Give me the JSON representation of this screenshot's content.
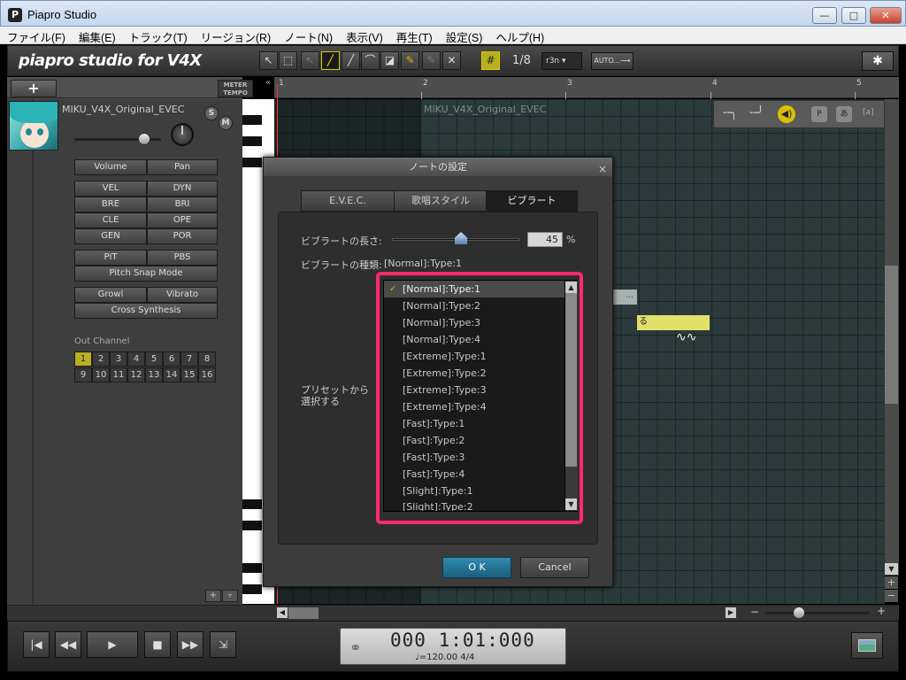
{
  "window": {
    "title": "Piapro Studio",
    "icon": "P",
    "min": "—",
    "max": "□",
    "close": "✕"
  },
  "menu": [
    "ファイル(F)",
    "編集(E)",
    "トラック(T)",
    "リージョン(R)",
    "ノート(N)",
    "表示(V)",
    "再生(T)",
    "設定(S)",
    "ヘルプ(H)"
  ],
  "toolbar": {
    "logo": "piapro studio for V4X",
    "snap_icon": "#",
    "snap_value": "1/8",
    "snap_mode": "r3n ▾",
    "auto_label": "AUTO...⟶",
    "settings_icon": "✱"
  },
  "track": {
    "add_label": "+",
    "meter_tempo": "METER TEMPO",
    "name": "MIKU_V4X_Original_EVEC",
    "solo": "S",
    "mute": "M",
    "buttons": [
      "Volume",
      "Pan",
      "VEL",
      "DYN",
      "BRE",
      "BRI",
      "CLE",
      "OPE",
      "GEN",
      "POR",
      "PIT",
      "PBS"
    ],
    "pitch_snap": "Pitch Snap Mode",
    "growl": "Growl",
    "vibrato": "Vibrato",
    "cross_synthesis": "Cross Synthesis",
    "out_channel_label": "Out Channel",
    "channels": [
      "1",
      "2",
      "3",
      "4",
      "5",
      "6",
      "7",
      "8",
      "9",
      "10",
      "11",
      "12",
      "13",
      "14",
      "15",
      "16"
    ],
    "active_channel": "1"
  },
  "ruler": [
    "1",
    "2",
    "3",
    "4",
    "5"
  ],
  "pianoroll": {
    "region_label": "MIKU_V4X_Original_EVEC",
    "note1_text": "...",
    "note2_text": "る",
    "vibrato_mark": "∿∿"
  },
  "dialog": {
    "title": "ノートの設定",
    "close": "×",
    "tabs": [
      "E.V.E.C.",
      "歌唱スタイル",
      "ビブラート"
    ],
    "active_tab": 2,
    "vib_length_label": "ビブラートの長さ:",
    "vib_length_value": "45",
    "vib_length_percent": 45,
    "vib_length_unit": "%",
    "vib_type_label": "ビブラートの種類:",
    "vib_type_value": "[Normal]:Type:1",
    "preset_label": "プリセットから選択する",
    "preset_label_line1": "プリセットから",
    "preset_label_line2": "選択する",
    "presets": [
      "[Normal]:Type:1",
      "[Normal]:Type:2",
      "[Normal]:Type:3",
      "[Normal]:Type:4",
      "[Extreme]:Type:1",
      "[Extreme]:Type:2",
      "[Extreme]:Type:3",
      "[Extreme]:Type:4",
      "[Fast]:Type:1",
      "[Fast]:Type:2",
      "[Fast]:Type:3",
      "[Fast]:Type:4",
      "[Slight]:Type:1",
      "[Slight]:Type:2"
    ],
    "selected_preset": 0,
    "check_mark": "✓",
    "ok_label": "O K",
    "cancel_label": "Cancel",
    "highlight_color": "#ff2a6a"
  },
  "transport": {
    "rewind_start": "|◀",
    "rewind": "◀◀",
    "play": "▶",
    "stop": "■",
    "forward": "▶▶",
    "loop": "⇲",
    "time": "000 1:01:000",
    "tempo": "♩=120.00  4/4",
    "link_icon": "⚭"
  }
}
